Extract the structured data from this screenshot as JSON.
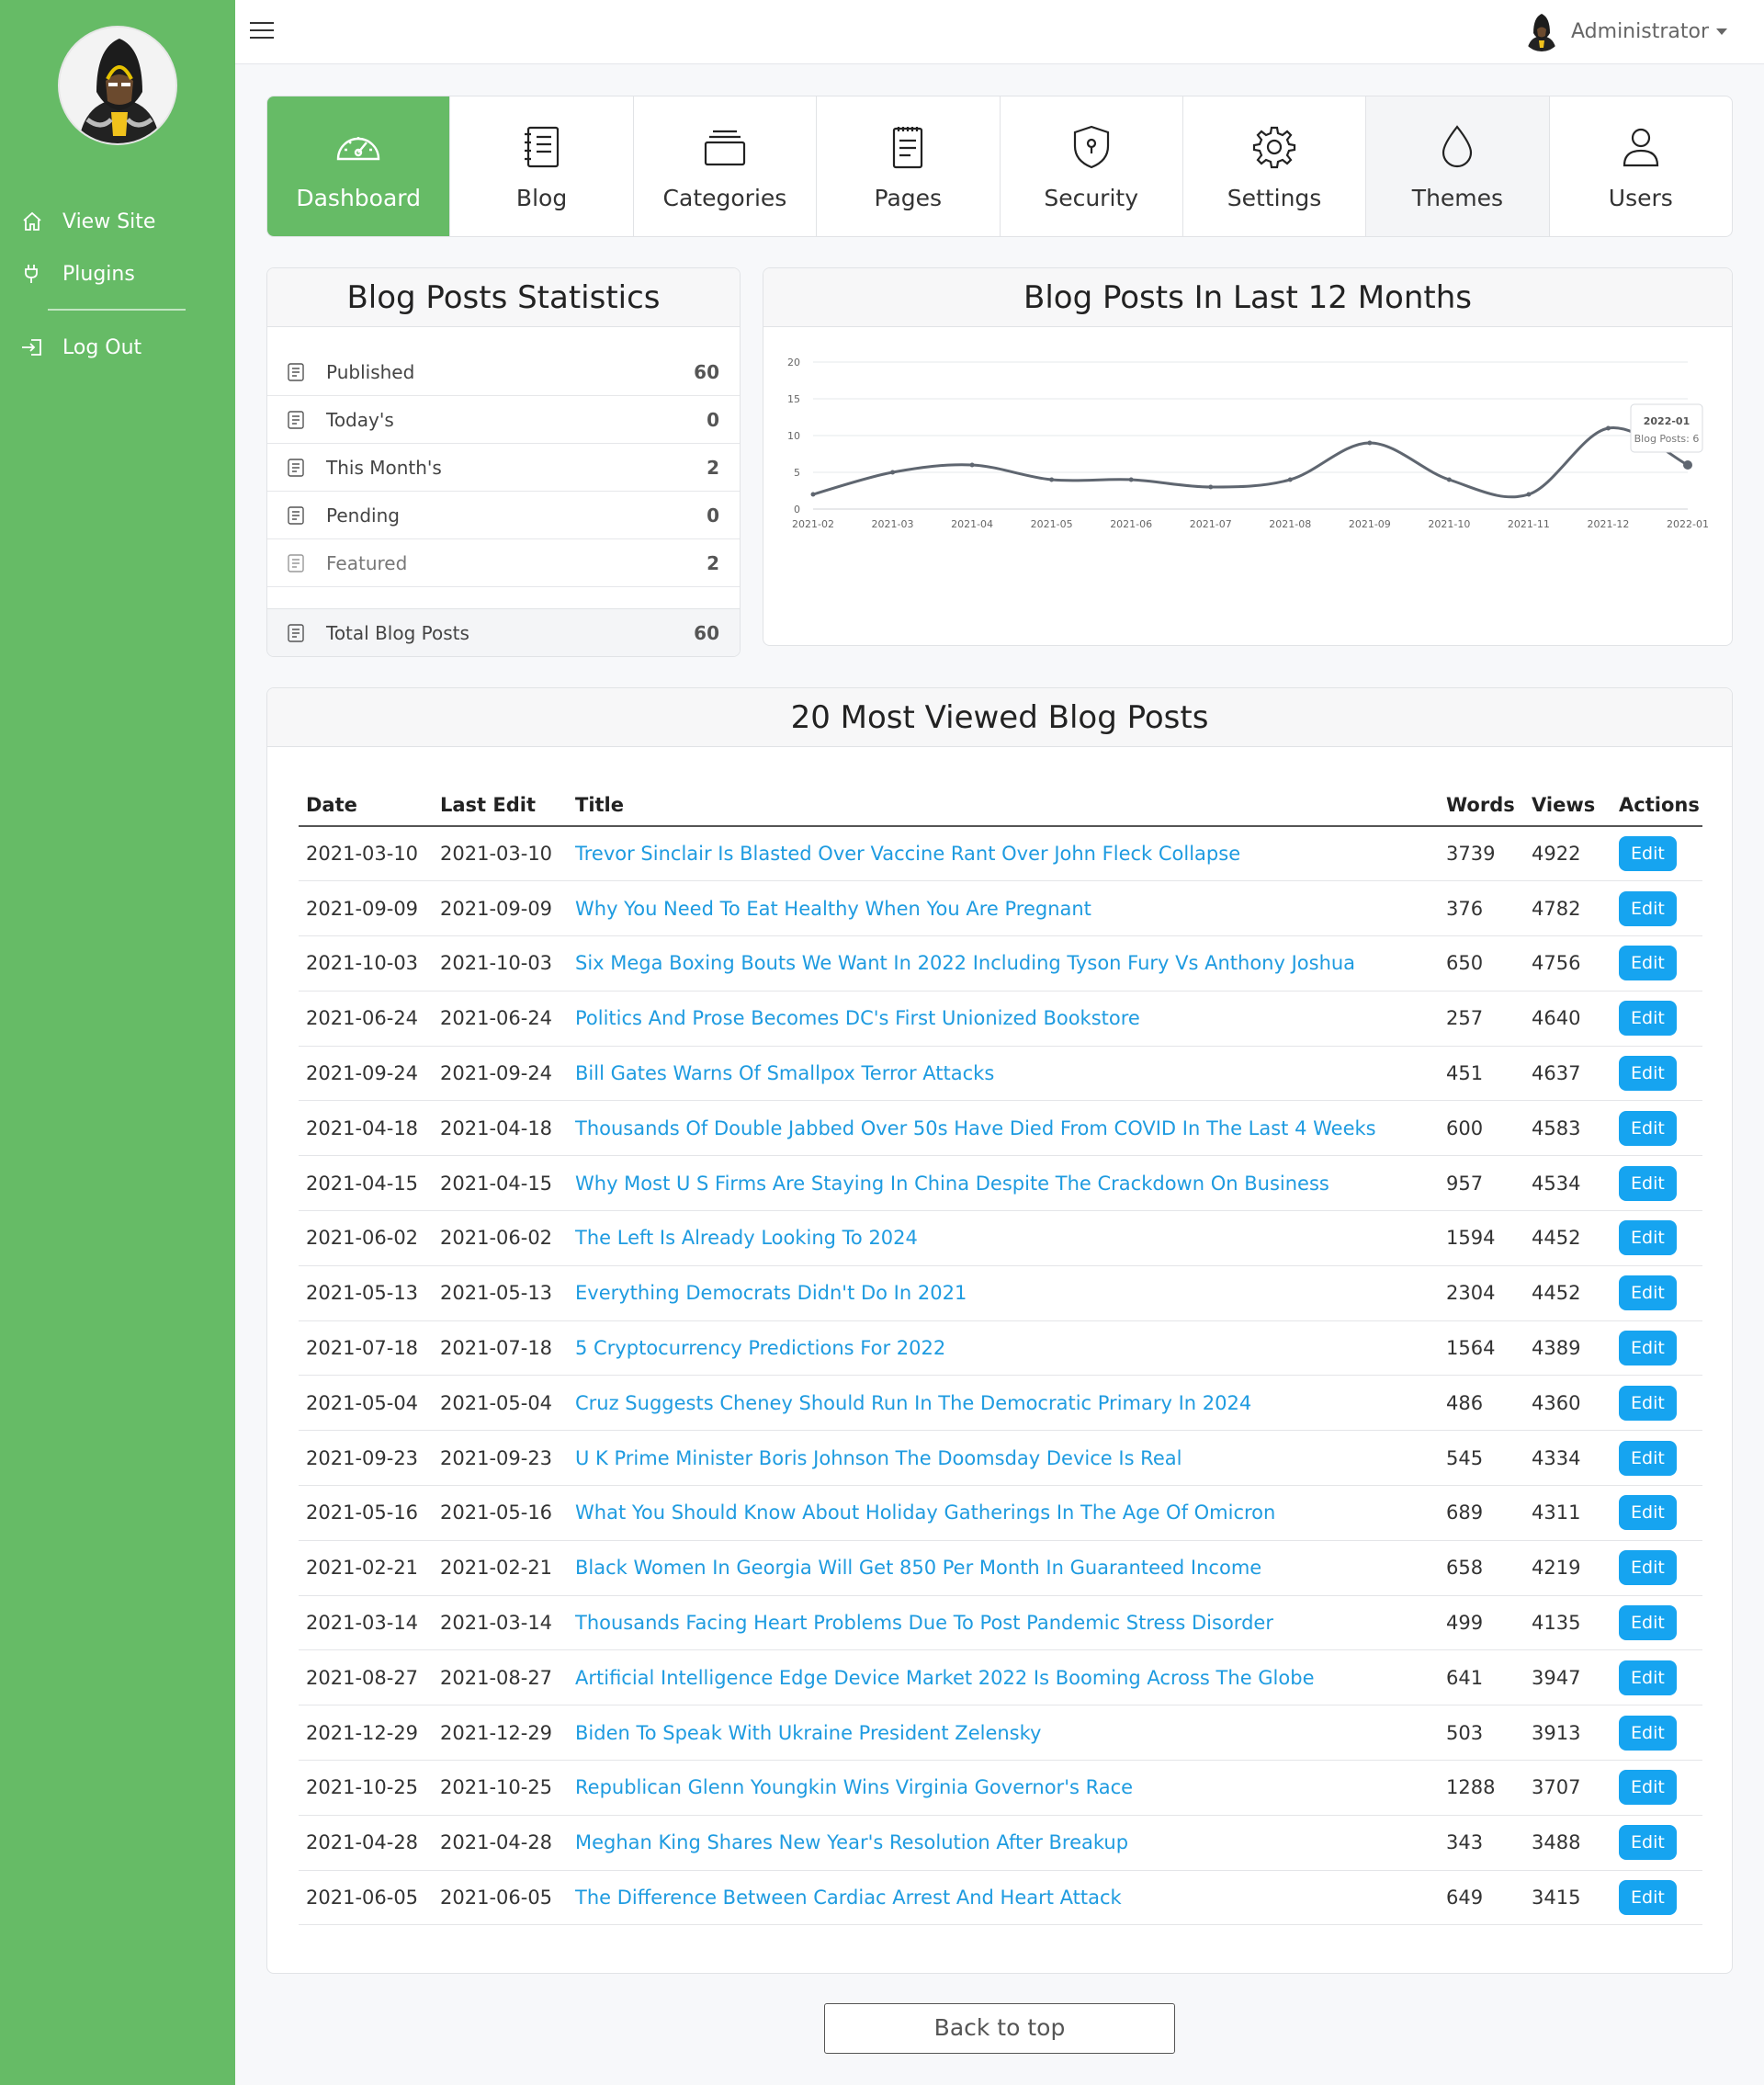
{
  "sidebar": {
    "items": [
      {
        "label": "View Site",
        "icon": "home-icon"
      },
      {
        "label": "Plugins",
        "icon": "plug-icon"
      },
      {
        "label": "Log Out",
        "icon": "logout-icon"
      }
    ]
  },
  "topbar": {
    "user_label": "Administrator"
  },
  "nav": {
    "tiles": [
      {
        "label": "Dashboard",
        "icon": "speedometer-icon"
      },
      {
        "label": "Blog",
        "icon": "notebook-icon"
      },
      {
        "label": "Categories",
        "icon": "stack-icon"
      },
      {
        "label": "Pages",
        "icon": "pages-icon"
      },
      {
        "label": "Security",
        "icon": "shield-icon"
      },
      {
        "label": "Settings",
        "icon": "gear-icon"
      },
      {
        "label": "Themes",
        "icon": "droplet-icon"
      },
      {
        "label": "Users",
        "icon": "user-icon"
      }
    ]
  },
  "stats": {
    "title": "Blog Posts Statistics",
    "rows": [
      {
        "label": "Published",
        "value": "60"
      },
      {
        "label": "Today's",
        "value": "0"
      },
      {
        "label": "This Month's",
        "value": "2"
      },
      {
        "label": "Pending",
        "value": "0"
      },
      {
        "label": "Featured",
        "value": "2"
      }
    ],
    "total": {
      "label": "Total Blog Posts",
      "value": "60"
    }
  },
  "chart_card": {
    "title": "Blog Posts In Last 12 Months"
  },
  "chart_data": {
    "type": "line",
    "title": "Blog Posts In Last 12 Months",
    "categories": [
      "2021-02",
      "2021-03",
      "2021-04",
      "2021-05",
      "2021-06",
      "2021-07",
      "2021-08",
      "2021-09",
      "2021-10",
      "2021-11",
      "2021-12",
      "2022-01"
    ],
    "series": [
      {
        "name": "Blog Posts",
        "values": [
          2,
          5,
          6,
          4,
          4,
          3,
          4,
          9,
          4,
          2,
          11,
          6
        ]
      }
    ],
    "ylim": [
      0,
      20
    ],
    "yticks": [
      "0",
      "5",
      "10",
      "15",
      "20"
    ],
    "grid": true,
    "tooltip": {
      "title": "2022-01",
      "text": "Blog Posts: 6"
    },
    "line_color": "#5f6670"
  },
  "posts": {
    "title": "20 Most Viewed Blog Posts",
    "columns": {
      "date": "Date",
      "last_edit": "Last Edit",
      "title": "Title",
      "words": "Words",
      "views": "Views",
      "actions": "Actions"
    },
    "edit_label": "Edit",
    "rows": [
      {
        "date": "2021-03-10",
        "last_edit": "2021-03-10",
        "title": "Trevor Sinclair Is Blasted Over Vaccine Rant Over John Fleck Collapse",
        "words": "3739",
        "views": "4922"
      },
      {
        "date": "2021-09-09",
        "last_edit": "2021-09-09",
        "title": "Why You Need To Eat Healthy When You Are Pregnant",
        "words": "376",
        "views": "4782"
      },
      {
        "date": "2021-10-03",
        "last_edit": "2021-10-03",
        "title": "Six Mega Boxing Bouts We Want In 2022 Including Tyson Fury Vs Anthony Joshua",
        "words": "650",
        "views": "4756"
      },
      {
        "date": "2021-06-24",
        "last_edit": "2021-06-24",
        "title": "Politics And Prose Becomes DC's First Unionized Bookstore",
        "words": "257",
        "views": "4640"
      },
      {
        "date": "2021-09-24",
        "last_edit": "2021-09-24",
        "title": "Bill Gates Warns Of Smallpox Terror Attacks",
        "words": "451",
        "views": "4637"
      },
      {
        "date": "2021-04-18",
        "last_edit": "2021-04-18",
        "title": "Thousands Of Double Jabbed Over 50s Have Died From COVID In The Last 4 Weeks",
        "words": "600",
        "views": "4583"
      },
      {
        "date": "2021-04-15",
        "last_edit": "2021-04-15",
        "title": "Why Most U S Firms Are Staying In China Despite The Crackdown On Business",
        "words": "957",
        "views": "4534"
      },
      {
        "date": "2021-06-02",
        "last_edit": "2021-06-02",
        "title": "The Left Is Already Looking To 2024",
        "words": "1594",
        "views": "4452"
      },
      {
        "date": "2021-05-13",
        "last_edit": "2021-05-13",
        "title": "Everything Democrats Didn't Do In 2021",
        "words": "2304",
        "views": "4452"
      },
      {
        "date": "2021-07-18",
        "last_edit": "2021-07-18",
        "title": "5 Cryptocurrency Predictions For 2022",
        "words": "1564",
        "views": "4389"
      },
      {
        "date": "2021-05-04",
        "last_edit": "2021-05-04",
        "title": "Cruz Suggests Cheney Should Run In The Democratic Primary In 2024",
        "words": "486",
        "views": "4360"
      },
      {
        "date": "2021-09-23",
        "last_edit": "2021-09-23",
        "title": "U K Prime Minister Boris Johnson The Doomsday Device Is Real",
        "words": "545",
        "views": "4334"
      },
      {
        "date": "2021-05-16",
        "last_edit": "2021-05-16",
        "title": "What You Should Know About Holiday Gatherings In The Age Of Omicron",
        "words": "689",
        "views": "4311"
      },
      {
        "date": "2021-02-21",
        "last_edit": "2021-02-21",
        "title": "Black Women In Georgia Will Get 850 Per Month In Guaranteed Income",
        "words": "658",
        "views": "4219"
      },
      {
        "date": "2021-03-14",
        "last_edit": "2021-03-14",
        "title": "Thousands Facing Heart Problems Due To Post Pandemic Stress Disorder",
        "words": "499",
        "views": "4135"
      },
      {
        "date": "2021-08-27",
        "last_edit": "2021-08-27",
        "title": "Artificial Intelligence Edge Device Market 2022 Is Booming Across The Globe",
        "words": "641",
        "views": "3947"
      },
      {
        "date": "2021-12-29",
        "last_edit": "2021-12-29",
        "title": "Biden To Speak With Ukraine President Zelensky",
        "words": "503",
        "views": "3913"
      },
      {
        "date": "2021-10-25",
        "last_edit": "2021-10-25",
        "title": "Republican Glenn Youngkin Wins Virginia Governor's Race",
        "words": "1288",
        "views": "3707"
      },
      {
        "date": "2021-04-28",
        "last_edit": "2021-04-28",
        "title": "Meghan King Shares New Year's Resolution After Breakup",
        "words": "343",
        "views": "3488"
      },
      {
        "date": "2021-06-05",
        "last_edit": "2021-06-05",
        "title": "The Difference Between Cardiac Arrest And Heart Attack",
        "words": "649",
        "views": "3415"
      }
    ]
  },
  "footer": {
    "back_to_top": "Back to top"
  },
  "colors": {
    "brand_green": "#66bb66",
    "link_blue": "#1e9be0",
    "button_blue": "#16a4f0"
  }
}
